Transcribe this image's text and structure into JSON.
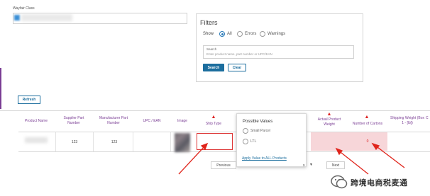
{
  "wayfair_class": {
    "label": "Wayfair Class"
  },
  "filters": {
    "title": "Filters",
    "show_label": "Show",
    "options": [
      {
        "label": "All",
        "selected": true
      },
      {
        "label": "Errors",
        "selected": false
      },
      {
        "label": "Warnings",
        "selected": false
      }
    ],
    "search_label": "Search",
    "search_placeholder": "Enter product name, part number or UPC/EAN",
    "search_button": "Search",
    "clear_button": "Clear"
  },
  "refresh_button": "Refresh",
  "table": {
    "columns": [
      "Product Name",
      "Supplier Part Number",
      "Manufacturer Part Number",
      "UPC / EAN",
      "Image",
      "Ship Type",
      "Actual Product Weight",
      "Number of Cartons",
      "Shipping Weight (Box 1 - [lb])",
      "C"
    ],
    "row": {
      "supplier_part_number": "123",
      "manufacturer_part_number": "123",
      "number_of_cartons": "0"
    }
  },
  "popup": {
    "title": "Possible Values",
    "options": [
      "Small Parcel",
      "LTL"
    ],
    "apply_link": "Apply Value to ALL Products"
  },
  "pagination": {
    "previous": "Previous",
    "page_suffix": "s",
    "next": "Next"
  },
  "watermark": "跨境电商税麦通",
  "colors": {
    "accent_purple": "#7a3d94",
    "primary_blue": "#1c6e9e",
    "error_red": "#d22222",
    "error_fill": "#f7d6d9"
  }
}
